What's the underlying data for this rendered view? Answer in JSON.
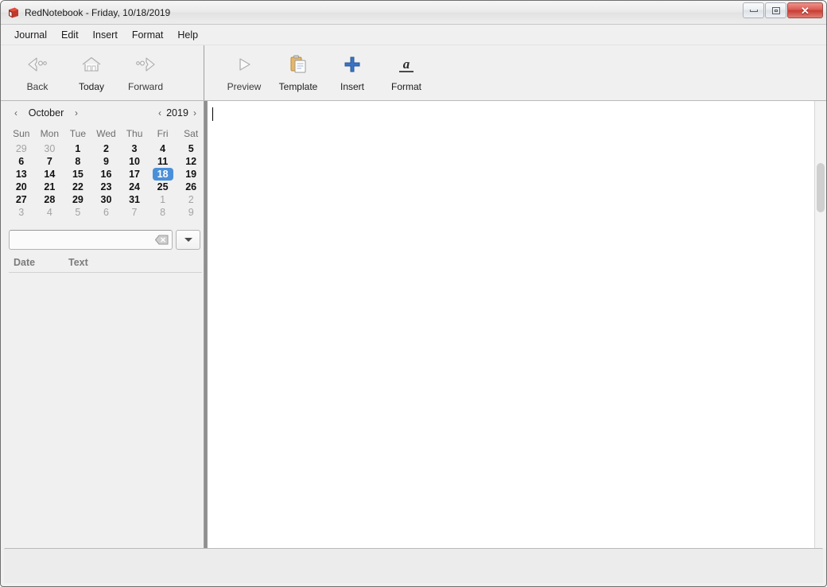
{
  "window": {
    "title": "RedNotebook - Friday, 10/18/2019",
    "icon": "red-notebook-icon",
    "controls": {
      "minimize": "minimize-button",
      "restore": "restore-button",
      "close": "✕"
    }
  },
  "menubar": {
    "items": [
      {
        "label": "Journal"
      },
      {
        "label": "Edit"
      },
      {
        "label": "Insert"
      },
      {
        "label": "Format"
      },
      {
        "label": "Help"
      }
    ]
  },
  "toolbar": {
    "navigation": [
      {
        "label": "Back",
        "icon": "back-arrow-icon",
        "enabled": false
      },
      {
        "label": "Today",
        "icon": "home-icon",
        "enabled": true
      },
      {
        "label": "Forward",
        "icon": "forward-arrow-icon",
        "enabled": false
      }
    ],
    "actions": [
      {
        "label": "Preview",
        "icon": "preview-play-icon",
        "enabled": false
      },
      {
        "label": "Template",
        "icon": "clipboard-icon",
        "enabled": true
      },
      {
        "label": "Insert",
        "icon": "plus-icon",
        "enabled": true
      },
      {
        "label": "Format",
        "icon": "format-a-icon",
        "enabled": true
      }
    ]
  },
  "calendar": {
    "month": "October",
    "year": "2019",
    "prev_month_arrow": "‹",
    "next_month_arrow": "›",
    "prev_year_arrow": "‹",
    "next_year_arrow": "›",
    "weekdays": [
      "Sun",
      "Mon",
      "Tue",
      "Wed",
      "Thu",
      "Fri",
      "Sat"
    ],
    "selected_day": 18,
    "accent_color": "#4a90d9",
    "weeks": [
      [
        {
          "d": "29",
          "adj": true
        },
        {
          "d": "30",
          "adj": true
        },
        {
          "d": "1",
          "adj": false
        },
        {
          "d": "2",
          "adj": false
        },
        {
          "d": "3",
          "adj": false
        },
        {
          "d": "4",
          "adj": false
        },
        {
          "d": "5",
          "adj": false
        }
      ],
      [
        {
          "d": "6",
          "adj": false
        },
        {
          "d": "7",
          "adj": false
        },
        {
          "d": "8",
          "adj": false
        },
        {
          "d": "9",
          "adj": false
        },
        {
          "d": "10",
          "adj": false
        },
        {
          "d": "11",
          "adj": false
        },
        {
          "d": "12",
          "adj": false
        }
      ],
      [
        {
          "d": "13",
          "adj": false
        },
        {
          "d": "14",
          "adj": false
        },
        {
          "d": "15",
          "adj": false
        },
        {
          "d": "16",
          "adj": false
        },
        {
          "d": "17",
          "adj": false
        },
        {
          "d": "18",
          "adj": false,
          "selected": true
        },
        {
          "d": "19",
          "adj": false
        }
      ],
      [
        {
          "d": "20",
          "adj": false
        },
        {
          "d": "21",
          "adj": false
        },
        {
          "d": "22",
          "adj": false
        },
        {
          "d": "23",
          "adj": false
        },
        {
          "d": "24",
          "adj": false
        },
        {
          "d": "25",
          "adj": false
        },
        {
          "d": "26",
          "adj": false
        }
      ],
      [
        {
          "d": "27",
          "adj": false
        },
        {
          "d": "28",
          "adj": false
        },
        {
          "d": "29",
          "adj": false
        },
        {
          "d": "30",
          "adj": false
        },
        {
          "d": "31",
          "adj": false
        },
        {
          "d": "1",
          "adj": true
        },
        {
          "d": "2",
          "adj": true
        }
      ],
      [
        {
          "d": "3",
          "adj": true
        },
        {
          "d": "4",
          "adj": true
        },
        {
          "d": "5",
          "adj": true
        },
        {
          "d": "6",
          "adj": true
        },
        {
          "d": "7",
          "adj": true
        },
        {
          "d": "8",
          "adj": true
        },
        {
          "d": "9",
          "adj": true
        }
      ]
    ]
  },
  "search": {
    "value": "",
    "placeholder": "",
    "clear_icon": "clear-backspace-icon",
    "dropdown_icon": "chevron-down-icon"
  },
  "results": {
    "columns": [
      "Date",
      "Text"
    ],
    "rows": []
  },
  "editor": {
    "content": "",
    "cursor_visible": true
  },
  "statusbar": {
    "text": ""
  }
}
